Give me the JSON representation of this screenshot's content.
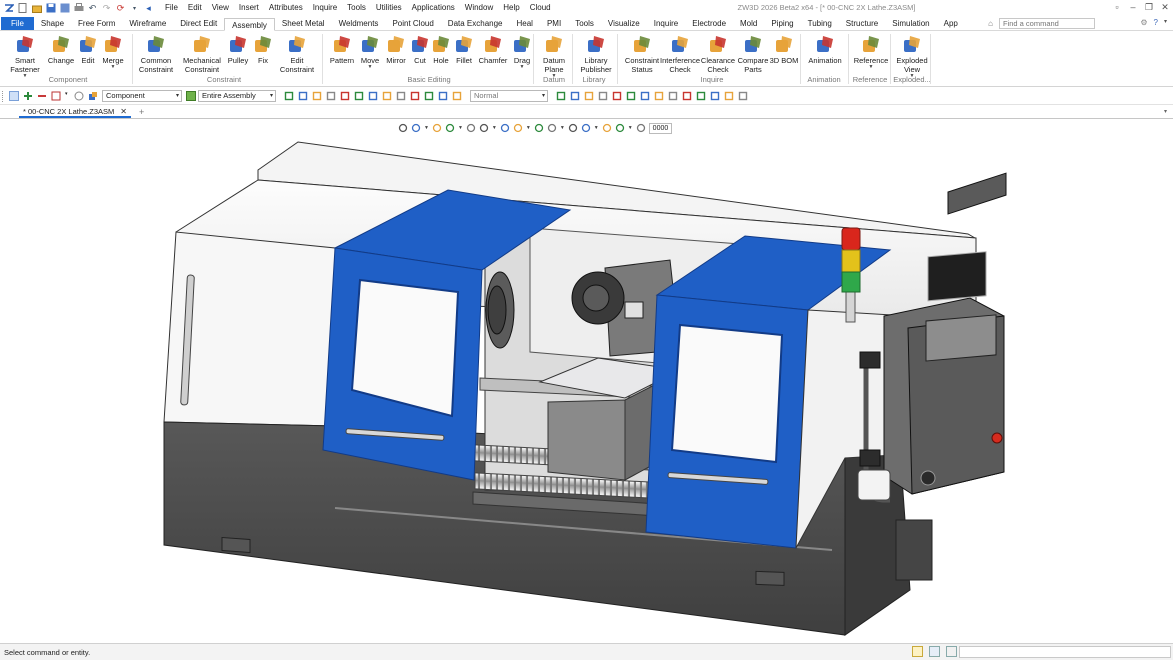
{
  "app": {
    "title": "ZW3D 2026 Beta2 x64 - [* 00-CNC 2X Lathe.Z3ASM]"
  },
  "menubar": {
    "items": [
      "File",
      "Edit",
      "View",
      "Insert",
      "Attributes",
      "Inquire",
      "Tools",
      "Utilities",
      "Applications",
      "Window",
      "Help",
      "Cloud"
    ]
  },
  "ribbon_tabs": {
    "file": "File",
    "items": [
      "Shape",
      "Free Form",
      "Wireframe",
      "Direct Edit",
      "Assembly",
      "Sheet Metal",
      "Weldments",
      "Point Cloud",
      "Data Exchange",
      "Heal",
      "PMI",
      "Tools",
      "Visualize",
      "Inquire",
      "Electrode",
      "Mold",
      "Piping",
      "Tubing",
      "Structure",
      "Simulation",
      "App"
    ],
    "active": "Assembly",
    "find_placeholder": "Find a command"
  },
  "ribbon": {
    "buttons": [
      {
        "id": "smart-fastener",
        "line1": "Smart",
        "line2": "Fastener",
        "caret": true,
        "icon": "smart-fastener-icon"
      },
      {
        "id": "change",
        "line1": "Change",
        "line2": "",
        "caret": false,
        "icon": "change-icon"
      },
      {
        "id": "edit",
        "line1": "Edit",
        "line2": "",
        "caret": false,
        "icon": "edit-icon"
      },
      {
        "id": "merge",
        "line1": "Merge",
        "line2": "",
        "caret": true,
        "icon": "merge-icon"
      },
      {
        "id": "common-constraint",
        "line1": "Common",
        "line2": "Constraint",
        "caret": false,
        "icon": "common-constraint-icon"
      },
      {
        "id": "mechanical-constraint",
        "line1": "Mechanical",
        "line2": "Constraint",
        "caret": false,
        "icon": "mechanical-constraint-icon"
      },
      {
        "id": "pulley",
        "line1": "Pulley",
        "line2": "",
        "caret": false,
        "icon": "pulley-icon"
      },
      {
        "id": "fix",
        "line1": "Fix",
        "line2": "",
        "caret": false,
        "icon": "fix-icon"
      },
      {
        "id": "edit-constraint",
        "line1": "Edit",
        "line2": "Constraint",
        "caret": false,
        "icon": "edit-constraint-icon"
      },
      {
        "id": "pattern",
        "line1": "Pattern",
        "line2": "",
        "caret": false,
        "icon": "pattern-icon"
      },
      {
        "id": "move",
        "line1": "Move",
        "line2": "",
        "caret": true,
        "icon": "move-icon"
      },
      {
        "id": "mirror",
        "line1": "Mirror",
        "line2": "",
        "caret": false,
        "icon": "mirror-icon"
      },
      {
        "id": "cut",
        "line1": "Cut",
        "line2": "",
        "caret": false,
        "icon": "cut-icon"
      },
      {
        "id": "hole",
        "line1": "Hole",
        "line2": "",
        "caret": false,
        "icon": "hole-icon"
      },
      {
        "id": "fillet",
        "line1": "Fillet",
        "line2": "",
        "caret": false,
        "icon": "fillet-icon"
      },
      {
        "id": "chamfer",
        "line1": "Chamfer",
        "line2": "",
        "caret": false,
        "icon": "chamfer-icon"
      },
      {
        "id": "drag",
        "line1": "Drag",
        "line2": "",
        "caret": true,
        "icon": "drag-icon"
      },
      {
        "id": "datum-plane",
        "line1": "Datum",
        "line2": "Plane",
        "caret": true,
        "icon": "datum-plane-icon"
      },
      {
        "id": "library-publisher",
        "line1": "Library",
        "line2": "Publisher",
        "caret": false,
        "icon": "library-publisher-icon"
      },
      {
        "id": "constraint-status",
        "line1": "Constraint",
        "line2": "Status",
        "caret": false,
        "icon": "constraint-status-icon"
      },
      {
        "id": "interference-check",
        "line1": "Interference",
        "line2": "Check",
        "caret": false,
        "icon": "interference-check-icon"
      },
      {
        "id": "clearance-check",
        "line1": "Clearance",
        "line2": "Check",
        "caret": false,
        "icon": "clearance-check-icon"
      },
      {
        "id": "compare-parts",
        "line1": "Compare",
        "line2": "Parts",
        "caret": false,
        "icon": "compare-parts-icon"
      },
      {
        "id": "3d-bom",
        "line1": "3D BOM",
        "line2": "",
        "caret": false,
        "icon": "bom-icon"
      },
      {
        "id": "animation",
        "line1": "Animation",
        "line2": "",
        "caret": false,
        "icon": "animation-icon"
      },
      {
        "id": "reference",
        "line1": "Reference",
        "line2": "",
        "caret": true,
        "icon": "reference-icon"
      },
      {
        "id": "exploded-view",
        "line1": "Exploded",
        "line2": "View",
        "caret": true,
        "icon": "exploded-view-icon"
      }
    ],
    "groups": [
      "Component",
      "Constraint",
      "Basic Editing",
      "Datum",
      "Library",
      "Inquire",
      "Animation",
      "Reference",
      "Exploded..."
    ]
  },
  "toolbar": {
    "filter_value": "Component",
    "scope_value": "Entire Assembly",
    "mode_value": "Normal"
  },
  "doc_tab": {
    "label": "* 00-CNC 2X Lathe.Z3ASM",
    "close": "✕",
    "add": "+"
  },
  "viewport": {
    "hud_readout": "0000"
  },
  "status": {
    "prompt": "Select command or entity."
  },
  "colors": {
    "accent": "#1f6bd1",
    "door_blue": "#1f5fc6",
    "base_dark": "#4a4a4a",
    "light_red": "#d9261c",
    "light_yellow": "#e3c21b",
    "light_green": "#2fa84a"
  }
}
